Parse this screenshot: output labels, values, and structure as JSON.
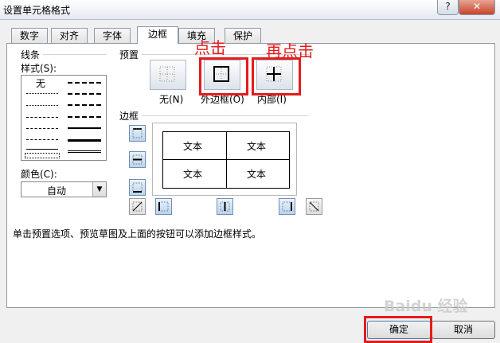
{
  "window": {
    "title": "设置单元格格式",
    "help": "?",
    "close": "✕"
  },
  "tabs": [
    "数字",
    "对齐",
    "字体",
    "边框",
    "填充",
    "保护"
  ],
  "active_tab": "边框",
  "line_group": {
    "title": "线条",
    "style_label": "样式(S):",
    "none_label": "无",
    "color_label": "颜色(C):",
    "color_value": "自动"
  },
  "presets": {
    "title": "预置",
    "items": [
      {
        "label": "无(N)"
      },
      {
        "label": "外边框(O)"
      },
      {
        "label": "内部(I)"
      }
    ]
  },
  "border_group": {
    "title": "边框"
  },
  "preview": {
    "cells": [
      "文本",
      "文本",
      "文本",
      "文本"
    ]
  },
  "hint": "单击预置选项、预览草图及上面的按钮可以添加边框样式。",
  "buttons": {
    "ok": "确定",
    "cancel": "取消"
  },
  "annotations": {
    "first": "点击",
    "second": "再点击"
  },
  "watermark": "Baidu 经验",
  "colors": {
    "highlight": "#e31c1c",
    "button_blue": "#b9d4ef"
  }
}
